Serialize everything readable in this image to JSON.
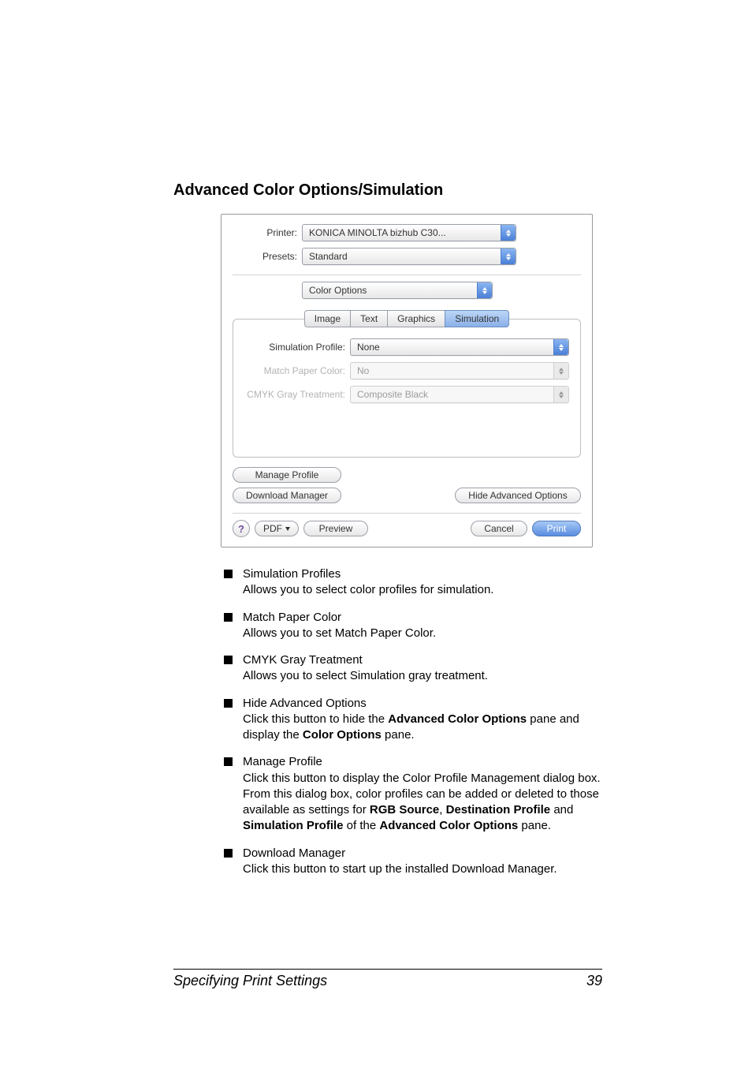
{
  "heading": "Advanced Color Options/Simulation",
  "dialog": {
    "printer_label": "Printer:",
    "printer_value": "KONICA MINOLTA bizhub C30...",
    "presets_label": "Presets:",
    "presets_value": "Standard",
    "pane_value": "Color Options",
    "tabs": [
      "Image",
      "Text",
      "Graphics",
      "Simulation"
    ],
    "active_tab_index": 3,
    "rows": {
      "sim_profile_label": "Simulation Profile:",
      "sim_profile_value": "None",
      "match_paper_label": "Match Paper Color:",
      "match_paper_value": "No",
      "cmyk_gray_label": "CMYK Gray Treatment:",
      "cmyk_gray_value": "Composite Black"
    },
    "buttons": {
      "manage_profile": "Manage Profile",
      "download_manager": "Download Manager",
      "hide_advanced": "Hide Advanced Options",
      "pdf": "PDF",
      "preview": "Preview",
      "cancel": "Cancel",
      "print": "Print",
      "help": "?"
    }
  },
  "bullets": [
    {
      "title": "Simulation Profiles",
      "desc_html": "Allows you to select color profiles for simulation."
    },
    {
      "title": "Match Paper Color",
      "desc_html": "Allows you to set Match Paper Color."
    },
    {
      "title": "CMYK Gray Treatment",
      "desc_html": "Allows you to select Simulation gray treatment."
    },
    {
      "title": "Hide Advanced Options",
      "desc_html": "Click this button to hide the <b>Advanced Color Options</b> pane and display the <b>Color Options</b> pane."
    },
    {
      "title": "Manage Profile",
      "desc_html": "Click this button to display the Color Profile Management dialog box. From this dialog box, color profiles can be added or deleted to those available as settings for <b>RGB Source</b>, <b>Destination Profile</b> and <b>Simulation Profile</b> of the <b>Advanced Color Options</b> pane."
    },
    {
      "title": "Download Manager",
      "desc_html": "Click this button to start up the installed Download Manager."
    }
  ],
  "footer": {
    "left": "Specifying Print Settings",
    "right": "39"
  }
}
